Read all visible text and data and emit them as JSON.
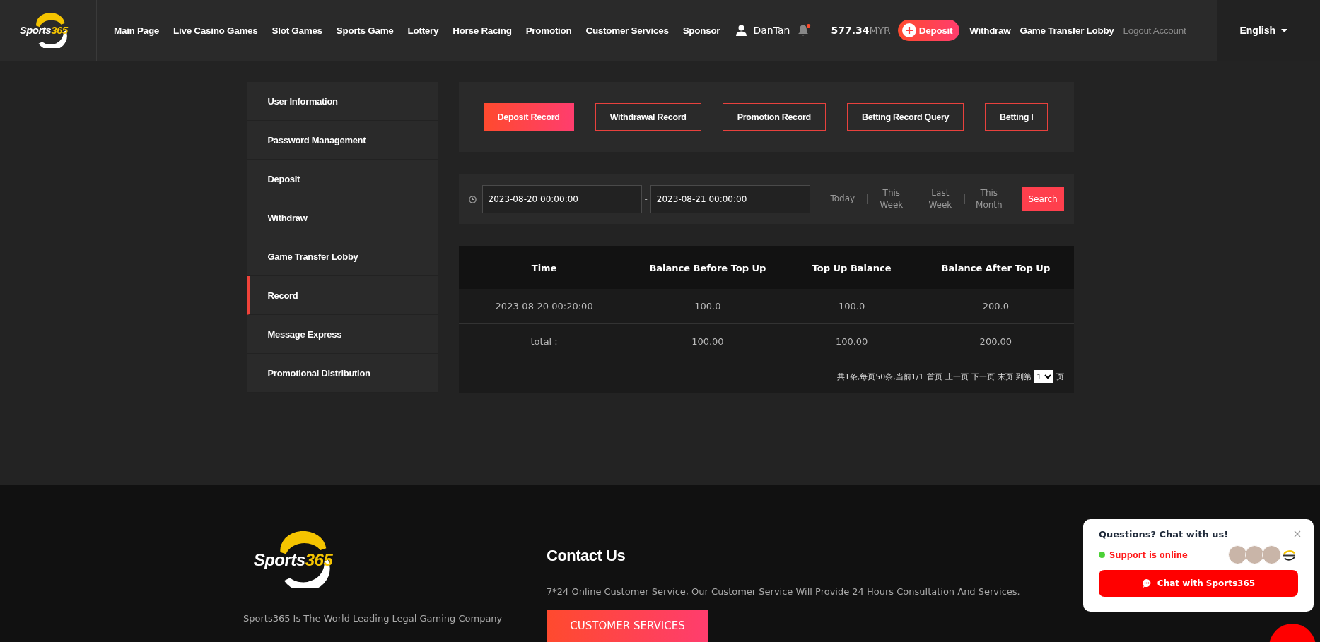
{
  "header": {
    "logo": {
      "word": "Sports",
      "number": "365"
    },
    "nav": [
      "Main Page",
      "Live Casino Games",
      "Slot Games",
      "Sports Game",
      "Lottery",
      "Horse Racing",
      "Promotion",
      "Customer Services",
      "Sponsor"
    ],
    "user": {
      "name": "DanTan",
      "has_notification": true
    },
    "balance": {
      "amount": "577.34",
      "currency": "MYR"
    },
    "deposit_button": "Deposit",
    "links": [
      {
        "label": "Withdraw",
        "disabled": false
      },
      {
        "label": "Game Transfer Lobby",
        "disabled": false
      },
      {
        "label": "Logout Account",
        "disabled": true
      }
    ],
    "language": "English"
  },
  "sidebar": {
    "items": [
      {
        "label": "User Information",
        "selected": false
      },
      {
        "label": "Password Management",
        "selected": false
      },
      {
        "label": "Deposit",
        "selected": false
      },
      {
        "label": "Withdraw",
        "selected": false
      },
      {
        "label": "Game Transfer Lobby",
        "selected": false
      },
      {
        "label": "Record",
        "selected": true
      },
      {
        "label": "Message Express",
        "selected": false
      },
      {
        "label": "Promotional Distribution",
        "selected": false
      }
    ]
  },
  "tabs": [
    {
      "label": "Deposit Record",
      "selected": true
    },
    {
      "label": "Withdrawal Record",
      "selected": false
    },
    {
      "label": "Promotion Record",
      "selected": false
    },
    {
      "label": "Betting Record Query",
      "selected": false
    },
    {
      "label": "Betting I",
      "selected": false
    }
  ],
  "filter": {
    "start": "2023-08-20 00:00:00",
    "separator": "-",
    "end": "2023-08-21 00:00:00",
    "quick": [
      "Today",
      "This Week",
      "Last Week",
      "This Month"
    ],
    "search_button": "Search"
  },
  "table": {
    "columns": [
      "Time",
      "Balance Before Top Up",
      "Top Up Balance",
      "Balance After Top Up"
    ],
    "rows": [
      [
        "2023-08-20 00:20:00",
        "100.0",
        "100.0",
        "200.0"
      ],
      [
        "total :",
        "100.00",
        "100.00",
        "200.00"
      ]
    ],
    "pagination": {
      "summary": "共1条,每页50条,当前1/1",
      "links": [
        "首页",
        "上一页",
        "下一页",
        "末页"
      ],
      "goto": "到第",
      "page": "1",
      "suffix": "页"
    }
  },
  "footer": {
    "logo": {
      "word": "Sports",
      "number": "365"
    },
    "tagline": "Sports365 Is The World Leading Legal Gaming Company",
    "contact_title": "Contact Us",
    "contact_text": "7*24 Online Customer Service, Our Customer Service Will Provide 24 Hours Consultation And Services.",
    "contact_button": "CUSTOMER SERVICES"
  },
  "chat_widget": {
    "title": "Questions? Chat with us!",
    "status": "Support is online",
    "online": true,
    "button": "Chat with Sports365"
  }
}
